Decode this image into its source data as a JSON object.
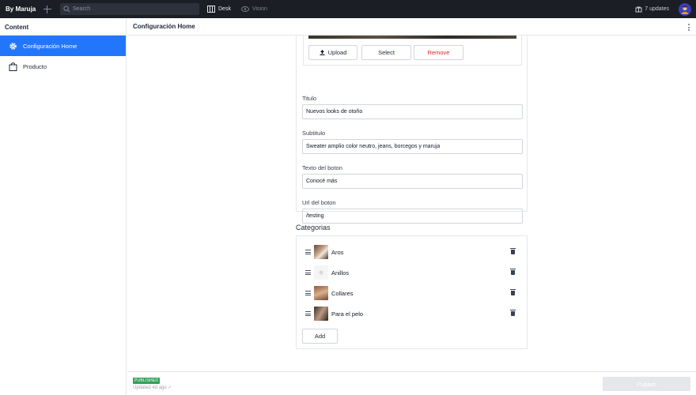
{
  "topbar": {
    "brand": "By Maruja",
    "search_placeholder": "Search",
    "nav": {
      "desk": "Desk",
      "vision": "Vision"
    },
    "updates": "7 updates"
  },
  "sidebar": {
    "title": "Content",
    "items": [
      {
        "label": "Configuración Home",
        "icon": "gear-icon",
        "active": true
      },
      {
        "label": "Producto",
        "icon": "bag-icon",
        "active": false
      }
    ]
  },
  "main": {
    "title": "Configuración Home",
    "image_buttons": {
      "upload": "Upload",
      "select": "Select",
      "remove": "Remove"
    },
    "fields": [
      {
        "label": "Titulo",
        "value": "Nuevos looks de otoño"
      },
      {
        "label": "Subtitulo",
        "value": "Sweater amplio color neutro, jeans, borcegos y maruja"
      },
      {
        "label": "Texto del boton",
        "value": "Conocé más"
      },
      {
        "label": "Url del boton",
        "value": "/testing"
      }
    ],
    "categories_title": "Categorias",
    "categories": [
      {
        "name": "Aros"
      },
      {
        "name": "Anillos"
      },
      {
        "name": "Collares"
      },
      {
        "name": "Para el pelo"
      }
    ],
    "add_label": "Add"
  },
  "footer": {
    "status": "PUBLISHED",
    "updated": "Updated 4d ago ✓",
    "publish": "Publish"
  },
  "colors": {
    "accent": "#2276fc",
    "danger": "#dc2626",
    "published": "#35a05a",
    "topbar": "#1b1e25"
  }
}
